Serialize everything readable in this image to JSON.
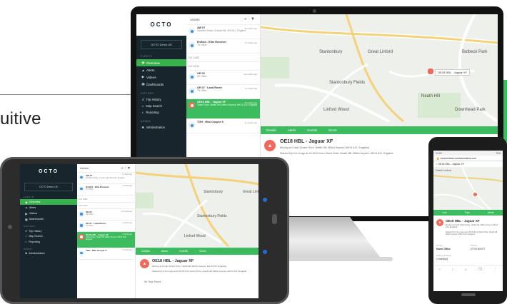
{
  "headline": "uitive",
  "app": {
    "logo": "OCTO",
    "demo_button": "OCTO Demo UK",
    "sections": {
      "fleets": "FLEETS",
      "history": "HISTORY",
      "admin": "ADMIN"
    },
    "nav": [
      {
        "label": "Overview",
        "icon": "eye-icon",
        "active": true
      },
      {
        "label": "Alerts",
        "icon": "alert-triangle-icon",
        "active": false
      },
      {
        "label": "Videos",
        "icon": "video-icon",
        "active": false
      },
      {
        "label": "Dashboards",
        "icon": "dashboard-icon",
        "active": false
      }
    ],
    "history_nav": [
      {
        "label": "Trip History",
        "icon": "route-icon"
      },
      {
        "label": "Map Search",
        "icon": "map-search-icon"
      },
      {
        "label": "Reporting",
        "icon": "report-icon"
      }
    ],
    "admin_nav": [
      {
        "label": "Administration",
        "icon": "gear-icon"
      }
    ],
    "list_title": "Assets",
    "list_icons": [
      "search-icon",
      "more-icon",
      "filter-icon"
    ],
    "list_items": [
      {
        "title": "AW 07",
        "sub": "Sandford Road, Crookes Hill, SD3 8LJ, England",
        "ago": "8 months ago",
        "selected": false
      },
      {
        "title": "Enfield - Elite Receiver",
        "sub": "TN Office",
        "ago": "3 months ago",
        "selected": false
      },
      {
        "title": "DC 1180",
        "sub": "",
        "ago": "",
        "selected": false,
        "plain": true
      },
      {
        "title": "DC 4131",
        "sub": "",
        "ago": "",
        "selected": false,
        "plain": true
      },
      {
        "title": "OE 03",
        "sub": "UK Office",
        "ago": "10 months ago",
        "selected": false
      },
      {
        "title": "OE 07 · Land Rover",
        "sub": "TN Office",
        "ago": "3 months ago",
        "selected": false
      },
      {
        "title": "OE18 HBL · Jaguar XF",
        "sub": "Tower Drive, Neath Hill, Milton Keynes, MK14 6JX, England",
        "ago": "8 months ago",
        "selected": true
      },
      {
        "title": "TGH · Mini Cooper S",
        "sub": "",
        "ago": "5 months ago",
        "selected": false
      }
    ],
    "map": {
      "places": [
        "Stantonbury",
        "Great Linford",
        "Bolbeck Park",
        "Stantonbury Fields",
        "Neath Hill",
        "Linford Wood",
        "Downhead Park"
      ],
      "vehicle_label": "OE18 HBL - Jaguar XF"
    },
    "detail": {
      "tabs": [
        "Details",
        "Alerts",
        "Events",
        "Score"
      ],
      "title": "OE18 HBL - Jaguar XF",
      "line1": "Moving at 0 mph (Tower Drive, Neath Hill, Milton Keynes, MK14 6JX, England)",
      "line2": "Started trip 0.6 mi ago at 10:16:04 from Tower Drive, Neath Hill, Milton Keynes, MK14 6JX, England",
      "trip_label": "Trips",
      "tablet_trip_label": "No Trips Found"
    }
  },
  "phone": {
    "status_left": "12:20",
    "status_right": "70%",
    "url": "newsenttals.octotelematics.com",
    "header_title": "OE18 HBL - Jaguar XF",
    "place": "Great Linford",
    "tabs": [
      "Live",
      "Trips",
      "Alerts"
    ],
    "title": "OE18 HBL - Jaguar XF",
    "line1": "Moving at 0 mph (Tower Drive, Neath Hill, Milton Keynes, MK14 6JX, England)",
    "line2": "Started trip 0.6 mi ago at 10:16:04 from Tower Drive, Neath Hill, Milton Keynes, MK14 6JX, England",
    "group_label": "Group",
    "group_value": "Home Office",
    "phone_label": "Phone",
    "phone_value": "07700 900077",
    "history_label": "History Settings",
    "history_value": "1 month(s)"
  },
  "colors": {
    "accent": "#3dbb5f",
    "sidebar": "#17252c",
    "alert": "#ef6a5a",
    "map": "#eef0ec"
  }
}
